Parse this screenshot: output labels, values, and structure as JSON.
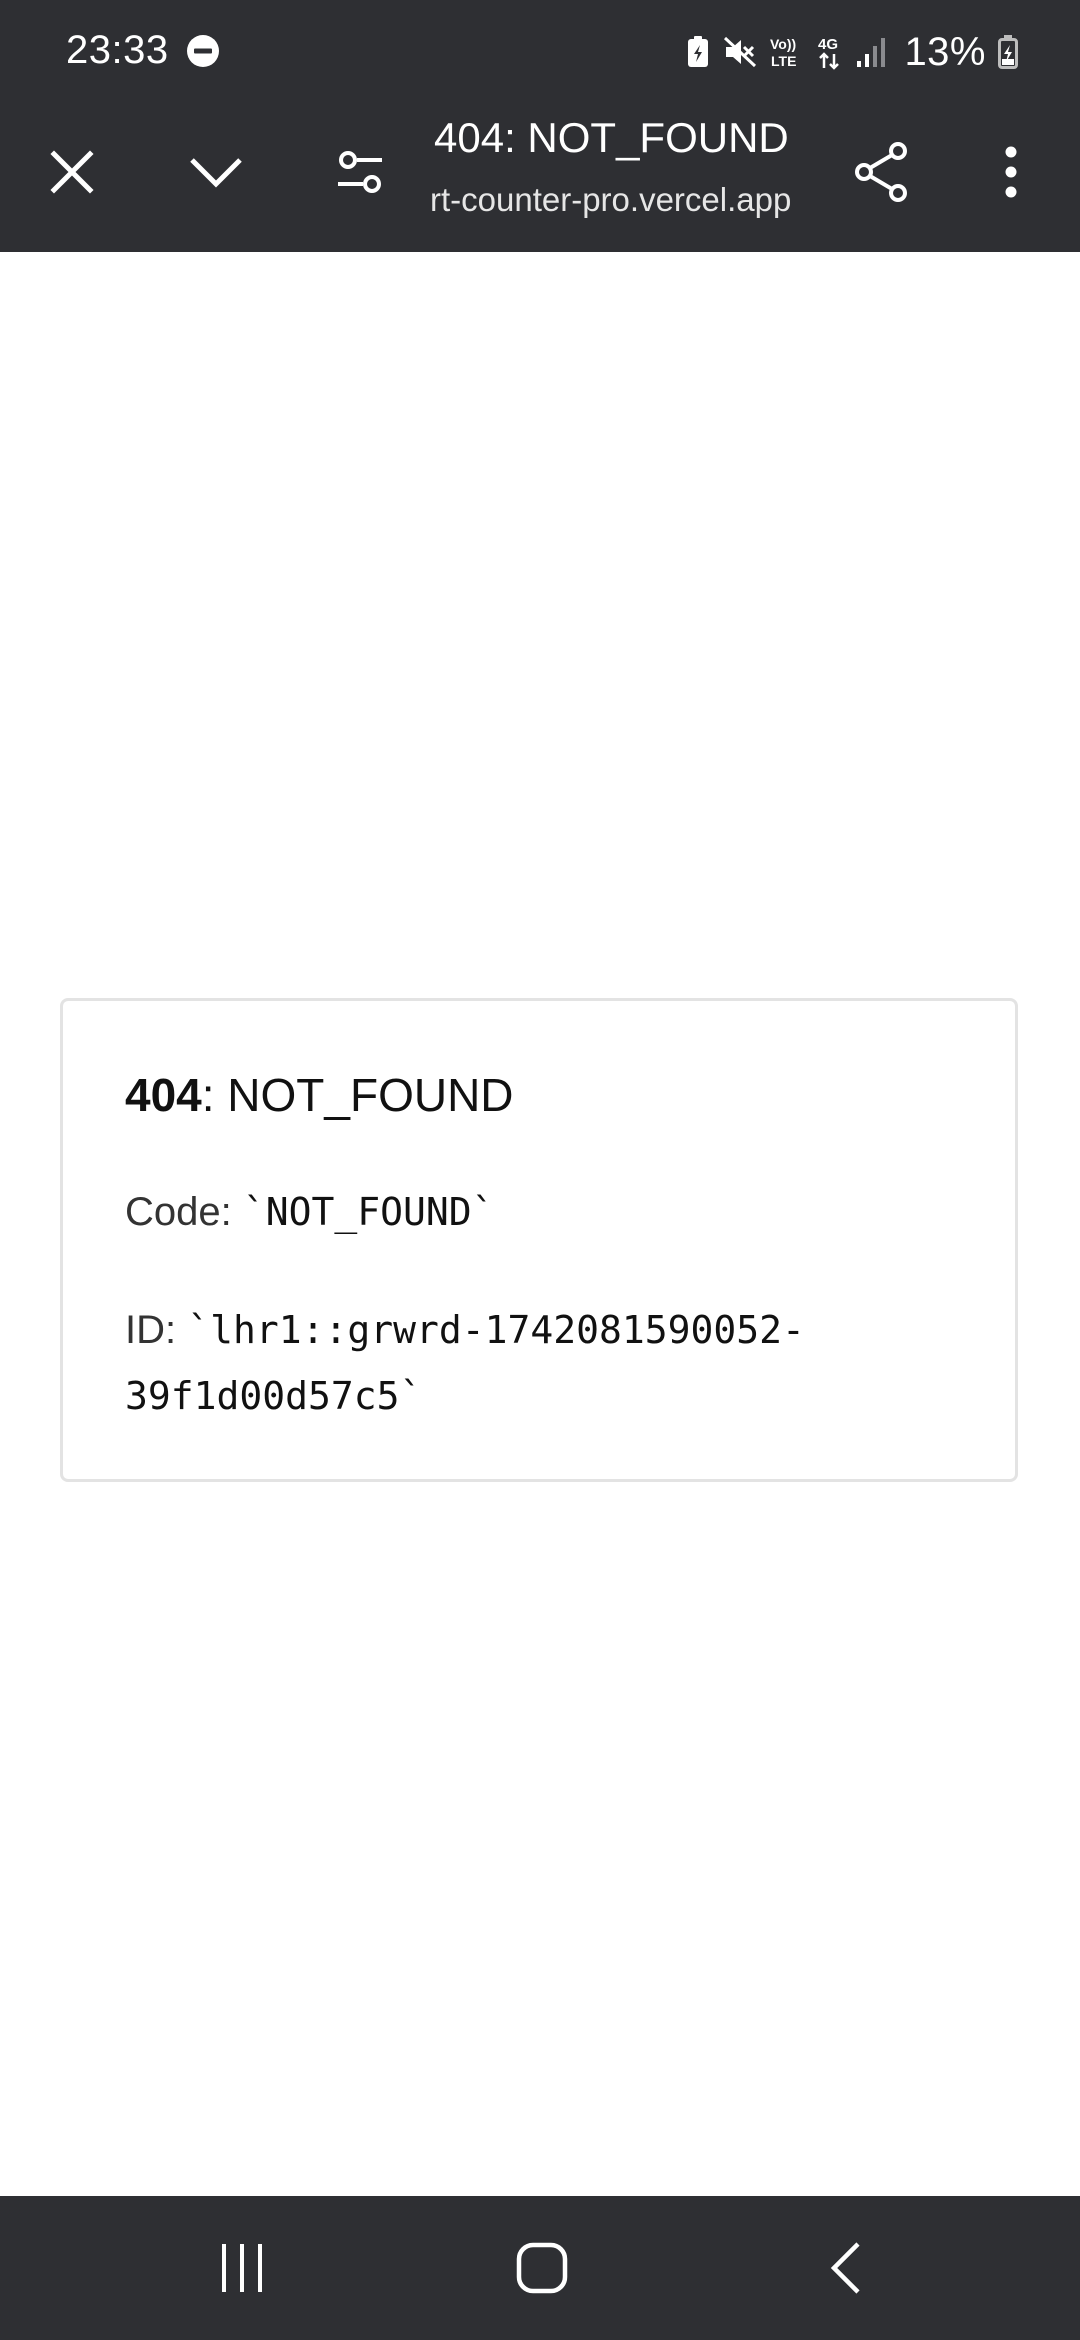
{
  "status_bar": {
    "time": "23:33",
    "battery_percent": "13%",
    "network": "4G",
    "volte": "Vo)) LTE",
    "icons": [
      "do-not-disturb-icon",
      "battery-saver-icon",
      "mute-icon",
      "volte-icon",
      "4g-data-icon",
      "signal-icon",
      "battery-charging-icon"
    ]
  },
  "toolbar": {
    "title": "404: NOT_FOUND",
    "url": "rt-counter-pro.vercel.app",
    "icons": [
      "close-icon",
      "chevron-down-icon",
      "page-settings-icon",
      "share-icon",
      "more-options-icon"
    ]
  },
  "error": {
    "status_code": "404",
    "heading_suffix": ": NOT_FOUND",
    "code_label": "Code: ",
    "code_value": "`NOT_FOUND`",
    "id_label": "ID: ",
    "id_value": "`lhr1::grwrd-1742081590052-39f1d00d57c5`"
  },
  "nav_bar": {
    "icons": [
      "recent-apps-icon",
      "home-icon",
      "back-icon"
    ]
  },
  "colors": {
    "chrome_background": "#2e2f33",
    "page_background": "#ffffff",
    "card_border": "#e3e3e3"
  }
}
